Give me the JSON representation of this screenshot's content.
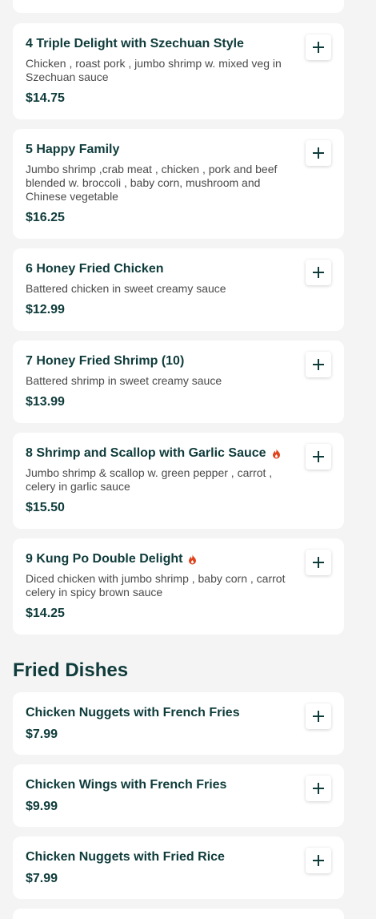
{
  "menu": {
    "items_top": [
      {
        "name": "4 Triple Delight with Szechuan Style",
        "description": "Chicken , roast pork , jumbo shrimp w. mixed veg in Szechuan sauce",
        "price": "$14.75",
        "spicy": false
      },
      {
        "name": "5 Happy Family",
        "description": "Jumbo shrimp ,crab meat , chicken , pork and beef blended w. broccoli , baby corn, mushroom and Chinese vegetable",
        "price": "$16.25",
        "spicy": false
      },
      {
        "name": "6 Honey Fried Chicken",
        "description": "Battered chicken in sweet creamy sauce",
        "price": "$12.99",
        "spicy": false
      },
      {
        "name": "7 Honey Fried Shrimp (10)",
        "description": "Battered shrimp in sweet creamy sauce",
        "price": "$13.99",
        "spicy": false
      },
      {
        "name": "8 Shrimp and Scallop with Garlic Sauce",
        "description": "Jumbo shrimp & scallop w. green pepper , carrot , celery in garlic sauce",
        "price": "$15.50",
        "spicy": true
      },
      {
        "name": "9 Kung Po Double Delight",
        "description": "Diced chicken with jumbo shrimp , baby corn , carrot celery in spicy brown sauce",
        "price": "$14.25",
        "spicy": true
      }
    ],
    "section_fried": {
      "title": "Fried Dishes",
      "items": [
        {
          "name": "Chicken Nuggets with French Fries",
          "price": "$7.99"
        },
        {
          "name": "Chicken Wings with French Fries",
          "price": "$9.99"
        },
        {
          "name": "Chicken Nuggets with Fried Rice",
          "price": "$7.99"
        }
      ]
    }
  },
  "icons": {
    "add": "plus-icon",
    "spicy": "flame-icon"
  },
  "colors": {
    "text_primary": "#0f3b3b",
    "text_secondary": "#4a4a4a",
    "spicy": "#e0431b",
    "background": "#f4f4f4",
    "card": "#ffffff"
  }
}
